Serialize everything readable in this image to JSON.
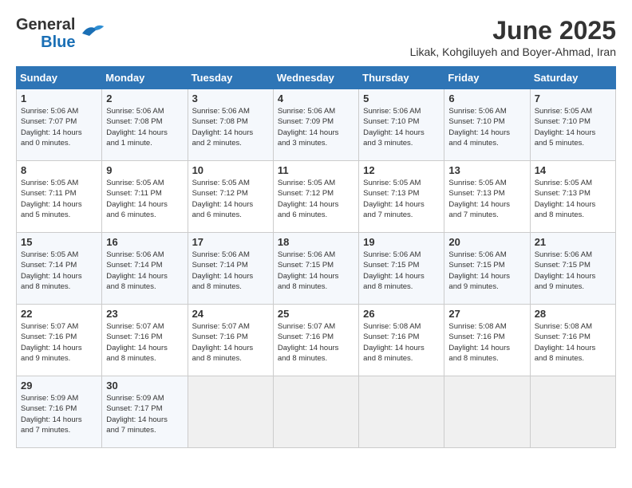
{
  "header": {
    "logo_line1": "General",
    "logo_line2": "Blue",
    "month": "June 2025",
    "location": "Likak, Kohgiluyeh and Boyer-Ahmad, Iran"
  },
  "weekdays": [
    "Sunday",
    "Monday",
    "Tuesday",
    "Wednesday",
    "Thursday",
    "Friday",
    "Saturday"
  ],
  "weeks": [
    [
      {
        "day": "1",
        "info": "Sunrise: 5:06 AM\nSunset: 7:07 PM\nDaylight: 14 hours\nand 0 minutes."
      },
      {
        "day": "2",
        "info": "Sunrise: 5:06 AM\nSunset: 7:08 PM\nDaylight: 14 hours\nand 1 minute."
      },
      {
        "day": "3",
        "info": "Sunrise: 5:06 AM\nSunset: 7:08 PM\nDaylight: 14 hours\nand 2 minutes."
      },
      {
        "day": "4",
        "info": "Sunrise: 5:06 AM\nSunset: 7:09 PM\nDaylight: 14 hours\nand 3 minutes."
      },
      {
        "day": "5",
        "info": "Sunrise: 5:06 AM\nSunset: 7:10 PM\nDaylight: 14 hours\nand 3 minutes."
      },
      {
        "day": "6",
        "info": "Sunrise: 5:06 AM\nSunset: 7:10 PM\nDaylight: 14 hours\nand 4 minutes."
      },
      {
        "day": "7",
        "info": "Sunrise: 5:05 AM\nSunset: 7:10 PM\nDaylight: 14 hours\nand 5 minutes."
      }
    ],
    [
      {
        "day": "8",
        "info": "Sunrise: 5:05 AM\nSunset: 7:11 PM\nDaylight: 14 hours\nand 5 minutes."
      },
      {
        "day": "9",
        "info": "Sunrise: 5:05 AM\nSunset: 7:11 PM\nDaylight: 14 hours\nand 6 minutes."
      },
      {
        "day": "10",
        "info": "Sunrise: 5:05 AM\nSunset: 7:12 PM\nDaylight: 14 hours\nand 6 minutes."
      },
      {
        "day": "11",
        "info": "Sunrise: 5:05 AM\nSunset: 7:12 PM\nDaylight: 14 hours\nand 6 minutes."
      },
      {
        "day": "12",
        "info": "Sunrise: 5:05 AM\nSunset: 7:13 PM\nDaylight: 14 hours\nand 7 minutes."
      },
      {
        "day": "13",
        "info": "Sunrise: 5:05 AM\nSunset: 7:13 PM\nDaylight: 14 hours\nand 7 minutes."
      },
      {
        "day": "14",
        "info": "Sunrise: 5:05 AM\nSunset: 7:13 PM\nDaylight: 14 hours\nand 8 minutes."
      }
    ],
    [
      {
        "day": "15",
        "info": "Sunrise: 5:05 AM\nSunset: 7:14 PM\nDaylight: 14 hours\nand 8 minutes."
      },
      {
        "day": "16",
        "info": "Sunrise: 5:06 AM\nSunset: 7:14 PM\nDaylight: 14 hours\nand 8 minutes."
      },
      {
        "day": "17",
        "info": "Sunrise: 5:06 AM\nSunset: 7:14 PM\nDaylight: 14 hours\nand 8 minutes."
      },
      {
        "day": "18",
        "info": "Sunrise: 5:06 AM\nSunset: 7:15 PM\nDaylight: 14 hours\nand 8 minutes."
      },
      {
        "day": "19",
        "info": "Sunrise: 5:06 AM\nSunset: 7:15 PM\nDaylight: 14 hours\nand 8 minutes."
      },
      {
        "day": "20",
        "info": "Sunrise: 5:06 AM\nSunset: 7:15 PM\nDaylight: 14 hours\nand 9 minutes."
      },
      {
        "day": "21",
        "info": "Sunrise: 5:06 AM\nSunset: 7:15 PM\nDaylight: 14 hours\nand 9 minutes."
      }
    ],
    [
      {
        "day": "22",
        "info": "Sunrise: 5:07 AM\nSunset: 7:16 PM\nDaylight: 14 hours\nand 9 minutes."
      },
      {
        "day": "23",
        "info": "Sunrise: 5:07 AM\nSunset: 7:16 PM\nDaylight: 14 hours\nand 8 minutes."
      },
      {
        "day": "24",
        "info": "Sunrise: 5:07 AM\nSunset: 7:16 PM\nDaylight: 14 hours\nand 8 minutes."
      },
      {
        "day": "25",
        "info": "Sunrise: 5:07 AM\nSunset: 7:16 PM\nDaylight: 14 hours\nand 8 minutes."
      },
      {
        "day": "26",
        "info": "Sunrise: 5:08 AM\nSunset: 7:16 PM\nDaylight: 14 hours\nand 8 minutes."
      },
      {
        "day": "27",
        "info": "Sunrise: 5:08 AM\nSunset: 7:16 PM\nDaylight: 14 hours\nand 8 minutes."
      },
      {
        "day": "28",
        "info": "Sunrise: 5:08 AM\nSunset: 7:16 PM\nDaylight: 14 hours\nand 8 minutes."
      }
    ],
    [
      {
        "day": "29",
        "info": "Sunrise: 5:09 AM\nSunset: 7:16 PM\nDaylight: 14 hours\nand 7 minutes."
      },
      {
        "day": "30",
        "info": "Sunrise: 5:09 AM\nSunset: 7:17 PM\nDaylight: 14 hours\nand 7 minutes."
      },
      {
        "day": "",
        "info": ""
      },
      {
        "day": "",
        "info": ""
      },
      {
        "day": "",
        "info": ""
      },
      {
        "day": "",
        "info": ""
      },
      {
        "day": "",
        "info": ""
      }
    ]
  ]
}
